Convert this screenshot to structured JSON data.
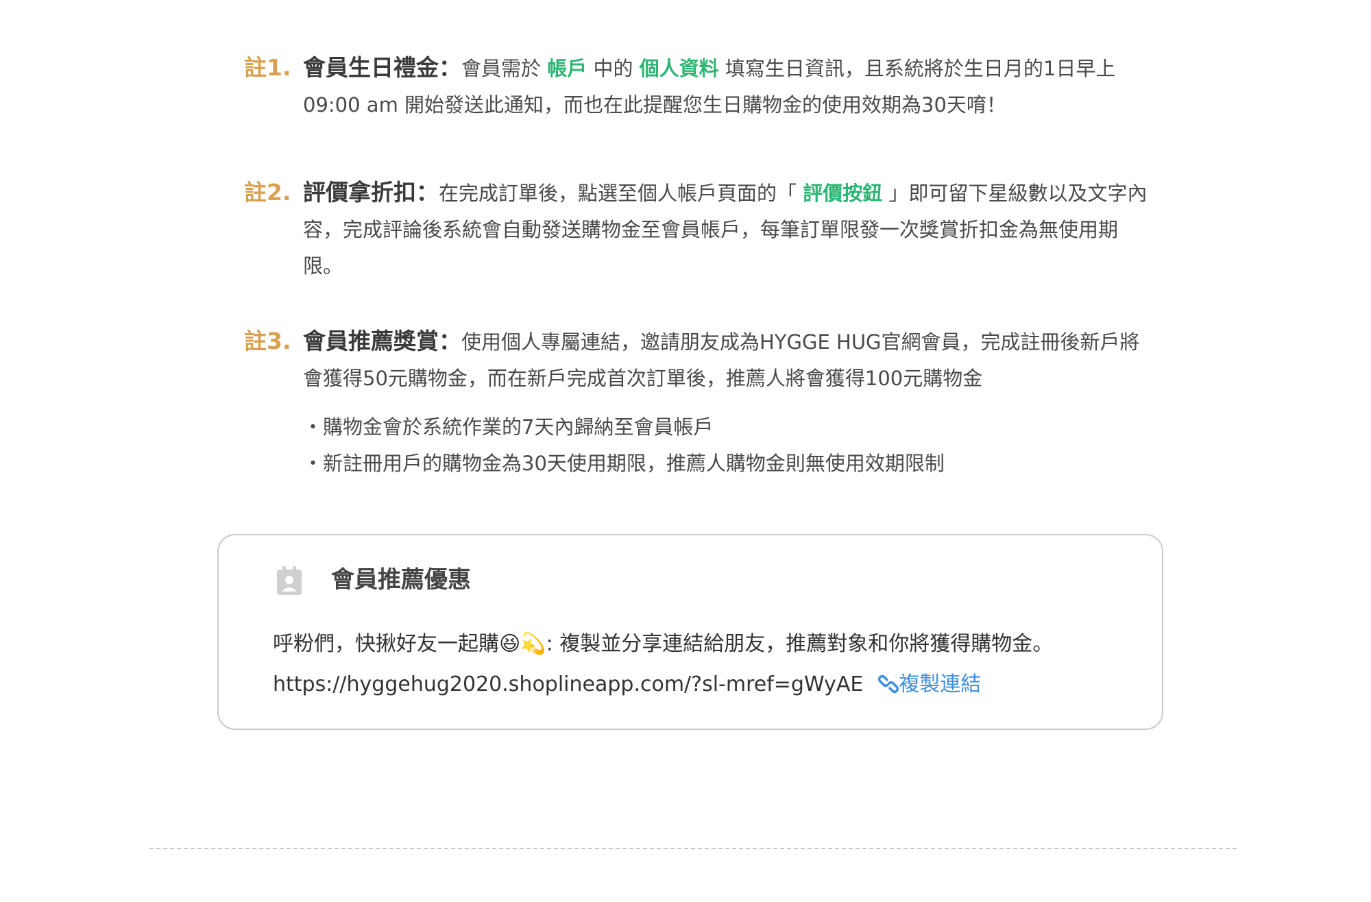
{
  "notes": [
    {
      "num": "註1.",
      "title": "會員生日禮金：",
      "text_a": "會員需於 ",
      "hl_a": "帳戶",
      "text_b": " 中的 ",
      "hl_b": "個人資料",
      "text_c": " 填寫生日資訊，且系統將於生日月的1日早上09:00 am 開始發送此通知，而也在此提醒您生日購物金的使用效期為30天唷！"
    },
    {
      "num": "註2.",
      "title": "評價拿折扣：",
      "text_a": "在完成訂單後，點選至個人帳戶頁面的「 ",
      "hl_a": "評價按鈕",
      "text_b": " 」即可留下星級數以及文字內容，完成評論後系統會自動發送購物金至會員帳戶，每筆訂單限發一次獎賞折扣金為無使用期限。"
    },
    {
      "num": "註3.",
      "title": "會員推薦獎賞：",
      "text_a": "使用個人專屬連結，邀請朋友成為HYGGE HUG官網會員，完成註冊後新戶將會獲得50元購物金，而在新戶完成首次訂單後，推薦人將會獲得100元購物金",
      "bullets": [
        "・購物金會於系統作業的7天內歸納至會員帳戶",
        "・新註冊用戶的購物金為30天使用期限，推薦人購物金則無使用效期限制"
      ]
    }
  ],
  "referral_card": {
    "icon": "member-card-icon",
    "title": "會員推薦優惠",
    "message": "呼粉們，快揪好友一起購😆💫: 複製並分享連結給朋友，推薦對象和你將獲得購物金。",
    "url": "https://hyggehug2020.shoplineapp.com/?sl-mref=gWyAE",
    "copy_icon": "link-icon",
    "copy_label": "複製連結"
  },
  "colors": {
    "note_number": "#d9a04e",
    "highlight": "#2bb673",
    "link": "#3d8fe0",
    "card_border": "#c9c9c9"
  }
}
